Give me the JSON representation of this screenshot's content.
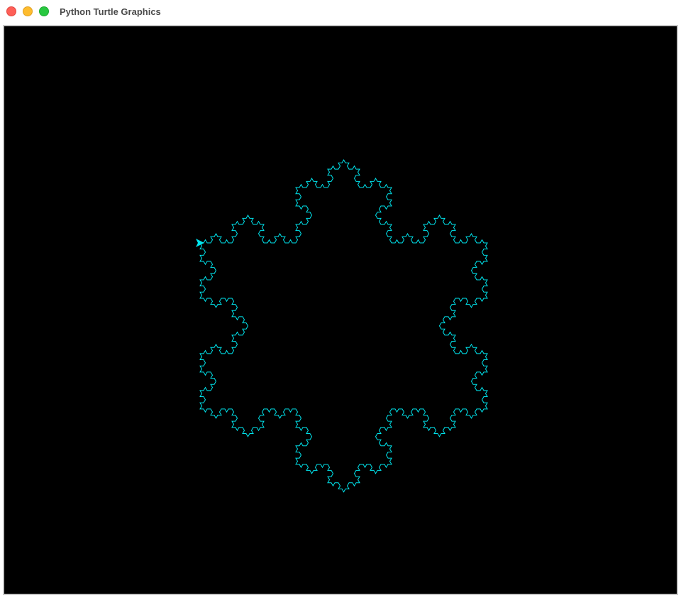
{
  "window": {
    "title": "Python Turtle Graphics"
  },
  "colors": {
    "canvas_background": "#000000",
    "pen": "#00e5ee",
    "title_text": "#4a4a4a",
    "close": "#fe5f57",
    "minimize": "#febc2e",
    "maximize": "#28c840"
  },
  "drawing": {
    "shape": "koch-snowflake",
    "iterations": 4,
    "turtle_heading": "east"
  }
}
